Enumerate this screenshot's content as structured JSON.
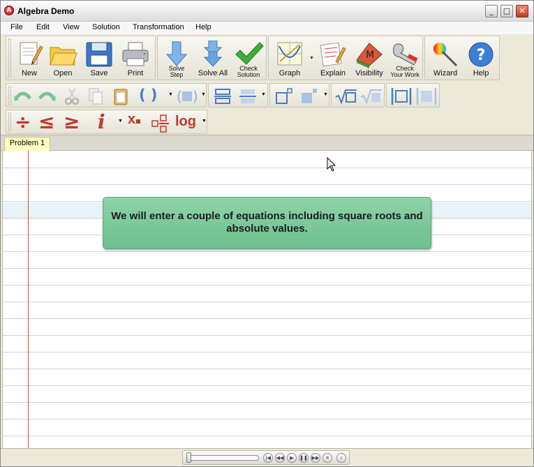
{
  "window": {
    "title": "Algebra Demo",
    "controls": {
      "minimize": "_",
      "maximize": "□",
      "close": "✕"
    }
  },
  "menu": [
    "File",
    "Edit",
    "View",
    "Solution",
    "Transformation",
    "Help"
  ],
  "toolbar_main": {
    "file_buttons": [
      "New",
      "Open",
      "Save",
      "Print"
    ],
    "solve_buttons": {
      "solve_step": [
        "Solve",
        "Step"
      ],
      "solve_all": "Solve All",
      "check_solution": [
        "Check",
        "Solution"
      ]
    },
    "tools": {
      "graph": "Graph",
      "explain": "Explain",
      "visibility": "Visibility",
      "visibility_badge": "M",
      "check_work": [
        "Check",
        "Your Work"
      ]
    },
    "help_buttons": {
      "wizard": "Wizard",
      "help": "Help",
      "help_glyph": "?"
    }
  },
  "toolbar_edit": {
    "icons": [
      "undo-icon",
      "redo-icon",
      "cut-icon",
      "copy-icon",
      "paste-icon",
      "parentheses-icon",
      "brackets-icon",
      "fraction-bar-icon",
      "fraction-dropdown-icon",
      "superscript-icon",
      "subscript-icon",
      "square-root-icon",
      "nth-root-icon",
      "absolute-value-icon",
      "box-icon"
    ],
    "parentheses_glyph": "( )"
  },
  "toolbar_math": {
    "divide": "÷",
    "less_equal": "≤",
    "greater_equal": "≥",
    "italic_i": "i",
    "subscript_x": "x",
    "log": "log"
  },
  "tabs": [
    "Problem 1"
  ],
  "worksheet": {
    "note": "We will enter a couple of equations including square roots and absolute values."
  },
  "player": {
    "buttons": [
      "|◀",
      "◀◀",
      "▶",
      "❚❚",
      "▶▶",
      "✕",
      "i"
    ]
  },
  "colors": {
    "accent_red": "#c0392b",
    "note_green": "#7cc89a",
    "margin_red": "#d9423a",
    "tab_yellow": "#fefec0"
  }
}
